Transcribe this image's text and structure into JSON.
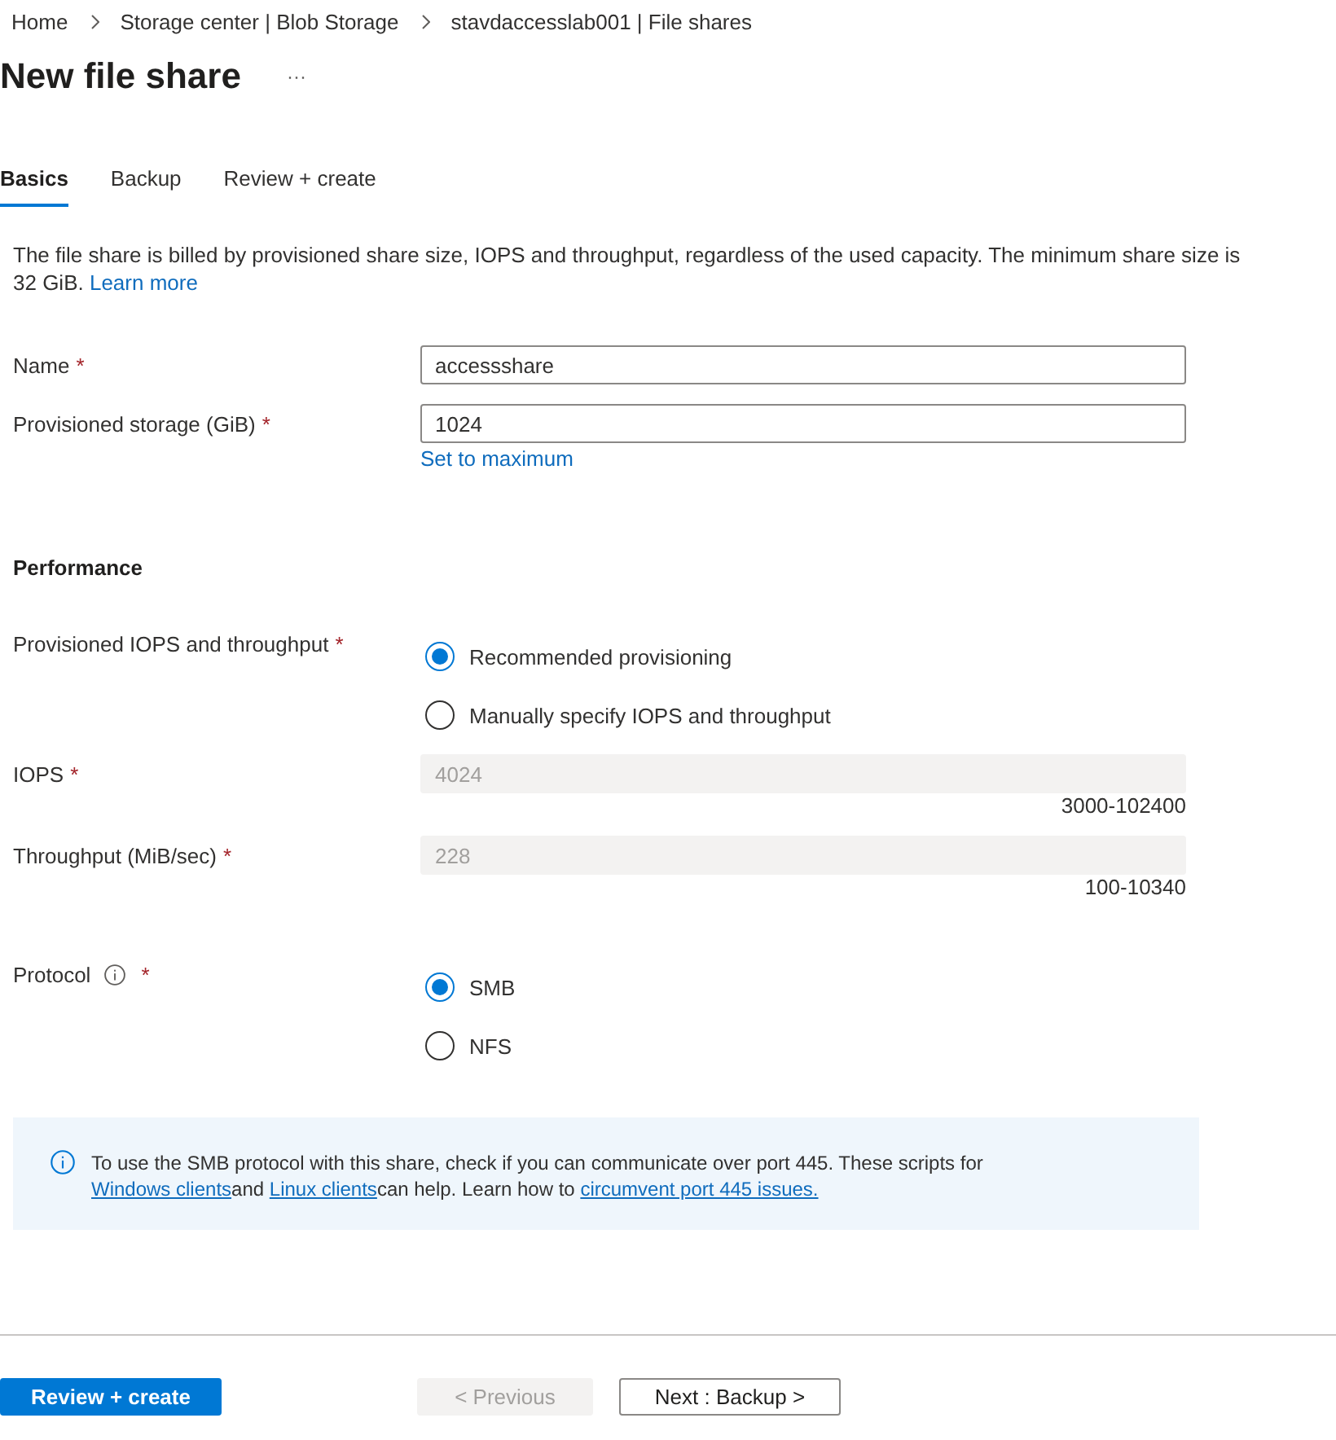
{
  "breadcrumb": [
    {
      "label": "Home"
    },
    {
      "label": "Storage center | Blob Storage"
    },
    {
      "label": "stavdaccesslab001 | File shares"
    }
  ],
  "page": {
    "title": "New file share",
    "more": "···"
  },
  "tabs": [
    {
      "label": "Basics",
      "selected": true
    },
    {
      "label": "Backup",
      "selected": false
    },
    {
      "label": "Review + create",
      "selected": false
    }
  ],
  "description": {
    "text": "The file share is billed by provisioned share size, IOPS and throughput, regardless of the used capacity. The minimum share size is 32 GiB.",
    "link": "Learn more"
  },
  "rows": [
    {
      "kind": "text",
      "label": "Name",
      "required": "*",
      "value": "accessshare",
      "disabled": false
    },
    {
      "kind": "text",
      "label": "Provisioned storage (GiB)",
      "required": "*",
      "value": "1024",
      "disabled": false,
      "link": "Set to maximum"
    },
    {
      "kind": "heading",
      "label": "Performance"
    },
    {
      "kind": "radio",
      "label": "Provisioned IOPS and throughput",
      "required": "*",
      "options": [
        {
          "label": "Recommended provisioning",
          "selected": true
        },
        {
          "label": "Manually specify IOPS and throughput",
          "selected": false
        }
      ]
    },
    {
      "kind": "text",
      "label": "IOPS",
      "required": "*",
      "value": "4024",
      "disabled": true,
      "range": "3000-102400"
    },
    {
      "kind": "text",
      "label": "Throughput (MiB/sec)",
      "required": "*",
      "value": "228",
      "disabled": true,
      "range": "100-10340"
    },
    {
      "kind": "radio",
      "label": "Protocol",
      "required": "*",
      "info_icon": true,
      "options": [
        {
          "label": "SMB",
          "selected": true
        },
        {
          "label": "NFS",
          "selected": false
        }
      ]
    }
  ],
  "info_banner": {
    "segments": [
      {
        "kind": "text",
        "text": "To use the SMB protocol with this share, check if you can communicate over port 445. These scripts for "
      },
      {
        "kind": "link",
        "text": "Windows clients"
      },
      {
        "kind": "text",
        "text": "and "
      },
      {
        "kind": "link",
        "text": "Linux clients"
      },
      {
        "kind": "text",
        "text": "can help. Learn how to "
      },
      {
        "kind": "link",
        "text": "circumvent port 445 issues."
      }
    ]
  },
  "buttons": [
    {
      "kind": "primary",
      "label": "Review + create",
      "disabled": false
    },
    {
      "kind": "secondary",
      "label": "< Previous",
      "disabled": true
    },
    {
      "kind": "secondary",
      "label": "Next : Backup >",
      "disabled": false
    }
  ]
}
